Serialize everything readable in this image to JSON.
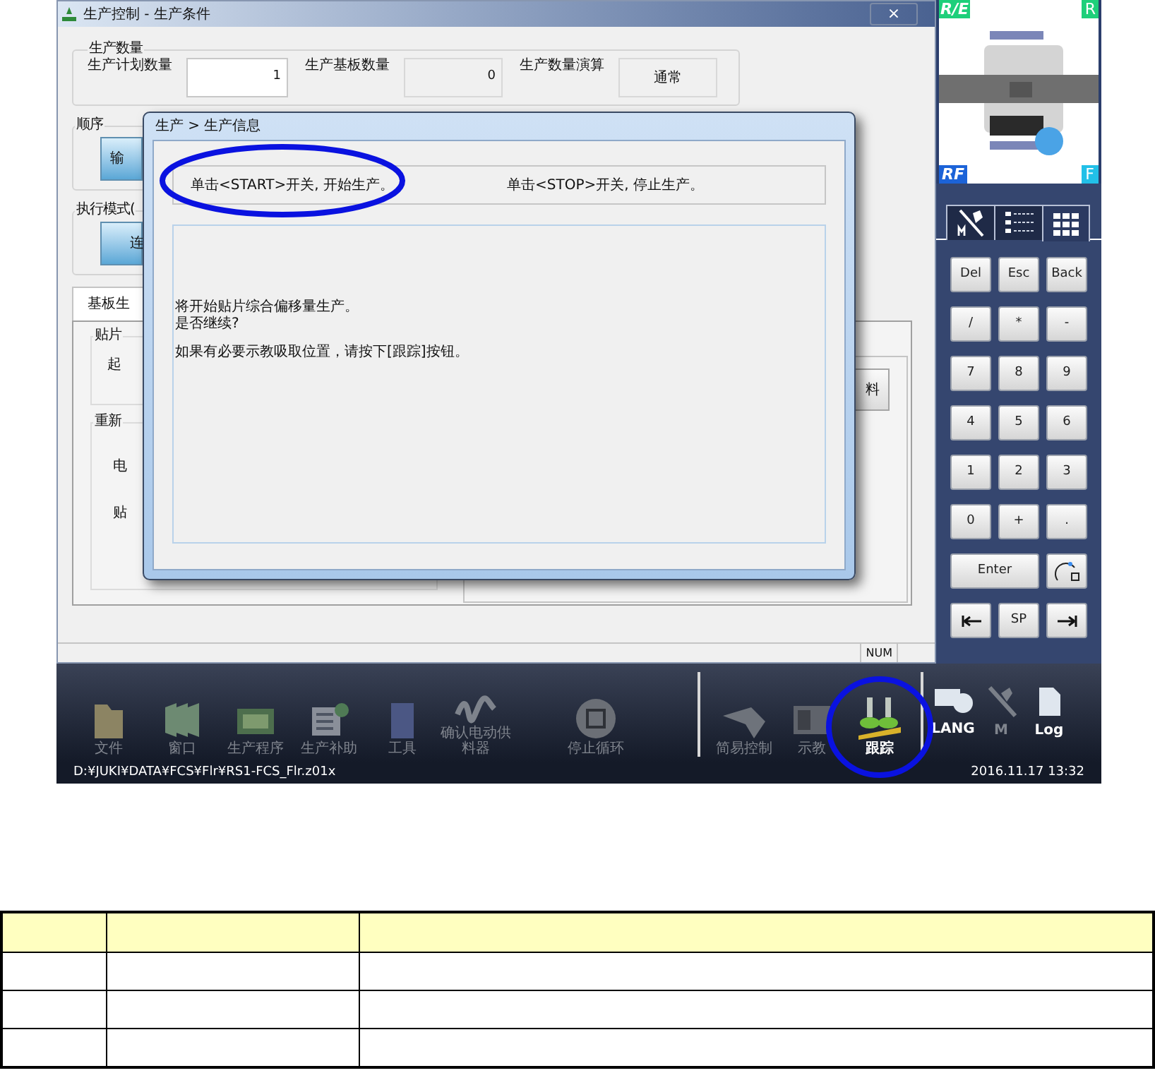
{
  "window": {
    "title": "生产控制 - 生产条件",
    "close": "×"
  },
  "production_quantity": {
    "legend": "生产数量",
    "plan_label": "生产计划数量",
    "plan_value": "1",
    "board_label": "生产基板数量",
    "board_value": "0",
    "calc_label": "生产数量演算",
    "calc_value": "通常"
  },
  "sequence": {
    "legend": "顺序",
    "button": "输"
  },
  "run_mode": {
    "legend": "执行模式(",
    "button": "连"
  },
  "tab": {
    "label": "基板生",
    "selected": true
  },
  "mount_group": {
    "legend": "贴片",
    "text": "起"
  },
  "redo_group": {
    "legend": "重新",
    "lines": [
      "电",
      "贴"
    ]
  },
  "side_button": "料",
  "indicator": "NUM",
  "dialog": {
    "title": "生产 > 生产信息",
    "hints": [
      "单击<START>开关, 开始生产。",
      "单击<STOP>开关, 停止生产。"
    ],
    "messages": [
      "将开始贴片综合偏移量生产。",
      "是否继续?",
      "如果有必要示教吸取位置，请按下[跟踪]按钮。"
    ]
  },
  "machine_view": {
    "corners": [
      "R/E",
      "R",
      "RF",
      "F"
    ]
  },
  "keypad": {
    "tabs": [
      {
        "selected": false
      },
      {
        "selected": false
      },
      {
        "selected": true
      }
    ],
    "keys": [
      {
        "kind": "text",
        "label": "Del"
      },
      {
        "kind": "text",
        "label": "Esc"
      },
      {
        "kind": "text",
        "label": "Back"
      },
      {
        "kind": "text",
        "label": "/"
      },
      {
        "kind": "text",
        "label": "*"
      },
      {
        "kind": "text",
        "label": "-"
      },
      {
        "kind": "text",
        "label": "7"
      },
      {
        "kind": "text",
        "label": "8"
      },
      {
        "kind": "text",
        "label": "9"
      },
      {
        "kind": "text",
        "label": "4"
      },
      {
        "kind": "text",
        "label": "5"
      },
      {
        "kind": "text",
        "label": "6"
      },
      {
        "kind": "text",
        "label": "1"
      },
      {
        "kind": "text",
        "label": "2"
      },
      {
        "kind": "text",
        "label": "3"
      },
      {
        "kind": "text",
        "label": "0"
      },
      {
        "kind": "text",
        "label": "+"
      },
      {
        "kind": "text",
        "label": "."
      },
      {
        "kind": "wide",
        "label": "Enter"
      },
      {
        "kind": "rotate"
      },
      {
        "kind": "tab-left"
      },
      {
        "kind": "text",
        "label": "SP"
      },
      {
        "kind": "tab-right"
      }
    ]
  },
  "toolbar": {
    "left": [
      {
        "label": "文件",
        "disabled": true
      },
      {
        "label": "窗口",
        "disabled": true
      },
      {
        "label": "生产程序",
        "disabled": true
      },
      {
        "label": "生产补助",
        "disabled": true
      },
      {
        "label": "工具",
        "disabled": true
      },
      {
        "label": "确认电动供料器",
        "disabled": true
      }
    ],
    "center": [
      {
        "label": "停止循环",
        "disabled": true
      }
    ],
    "right": [
      {
        "label": "简易控制",
        "disabled": true
      },
      {
        "label": "示教",
        "disabled": true
      },
      {
        "label": "跟踪",
        "disabled": false
      }
    ],
    "system": [
      {
        "label": "LANG",
        "disabled": false
      },
      {
        "label": "M",
        "disabled": true
      },
      {
        "label": "Log",
        "disabled": false
      }
    ]
  },
  "status_bar": {
    "path": "D:¥JUKI¥DATA¥FCS¥Flr¥RS1-FCS_Flr.z01x",
    "time": "2016.11.17 13:32"
  },
  "table": {
    "rows": [
      {
        "kind": "header"
      },
      {
        "kind": "body"
      },
      {
        "kind": "body"
      },
      {
        "kind": "body"
      }
    ]
  }
}
